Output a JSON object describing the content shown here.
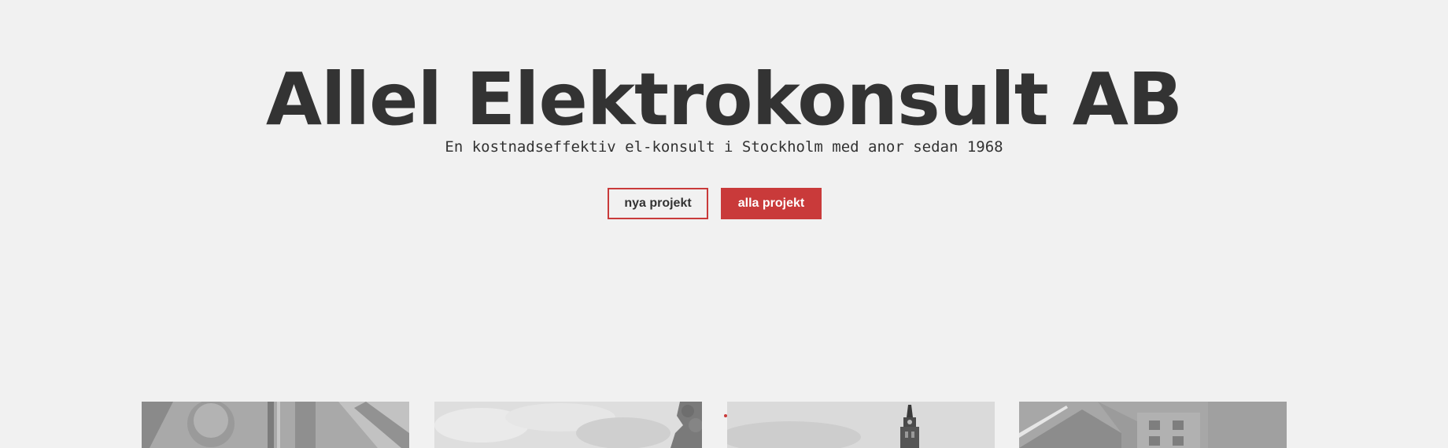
{
  "hero": {
    "title": "Allel Elektrokonsult AB",
    "subtitle": "En kostnadseffektiv el-konsult i Stockholm med anor sedan 1968"
  },
  "actions": {
    "new_projects_label": "nya projekt",
    "all_projects_label": "alla projekt"
  },
  "colors": {
    "background": "#f1f1f1",
    "text": "#333333",
    "accent": "#c93a3a"
  },
  "projects": [
    {
      "image": "industrial-pipes-photo"
    },
    {
      "image": "clouds-and-tree-photo"
    },
    {
      "image": "church-tower-photo"
    },
    {
      "image": "building-facade-photo"
    }
  ]
}
